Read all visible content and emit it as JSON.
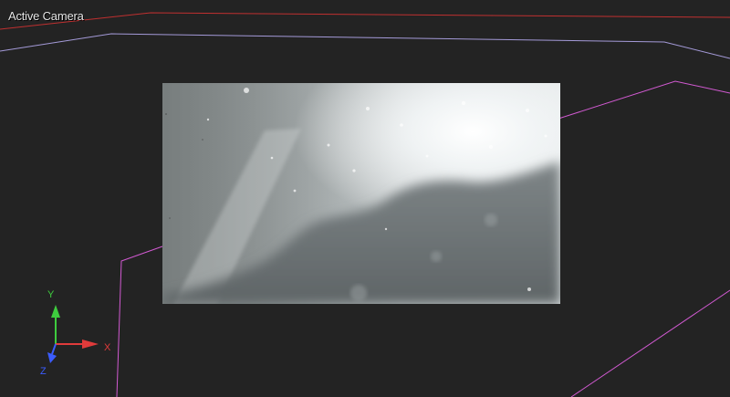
{
  "viewport": {
    "label": "Active Camera",
    "background_color": "#232323"
  },
  "scene_lines": {
    "red_boundary_color": "#c03030",
    "lavender_boundary_color": "#a49ad8",
    "magenta_frustum_color": "#d25ad2"
  },
  "camera_preview": {
    "description_icon": "camera-preview-image"
  },
  "axis_gizmo": {
    "x_label": "X",
    "y_label": "Y",
    "z_label": "Z",
    "x_color": "#e03b3b",
    "y_color": "#3ecc3e",
    "z_color": "#3b5cff"
  }
}
